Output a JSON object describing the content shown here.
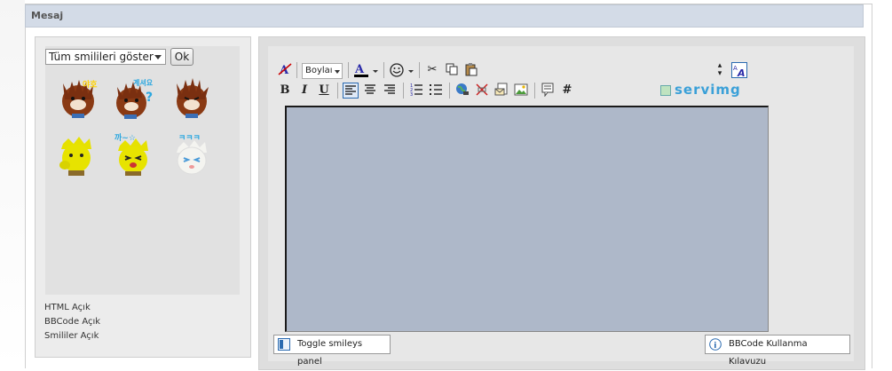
{
  "section": {
    "title": "Mesaj"
  },
  "smilies": {
    "select_value": "Tüm smilileri göster",
    "ok_label": "Ok",
    "items": [
      "bear-1",
      "bear-2",
      "bear-3",
      "yellow-1",
      "yellow-2",
      "white-1"
    ]
  },
  "status": {
    "html": "HTML Açık",
    "bbcode": "BBCode Açık",
    "smilies": "Smililer Açık"
  },
  "toolbar": {
    "font_size": "Boylaı",
    "servimg": "servimg",
    "bold": "B",
    "italic": "I",
    "underline": "U",
    "hash": "#"
  },
  "footer": {
    "toggle_smileys": "Toggle smileys panel",
    "bbcode_guide": "BBCode Kullanma Kılavuzu"
  },
  "colors": {
    "header_bg": "#d3dbe7",
    "textarea_bg": "#aeb8c9",
    "brand": "#3aa0d8"
  }
}
